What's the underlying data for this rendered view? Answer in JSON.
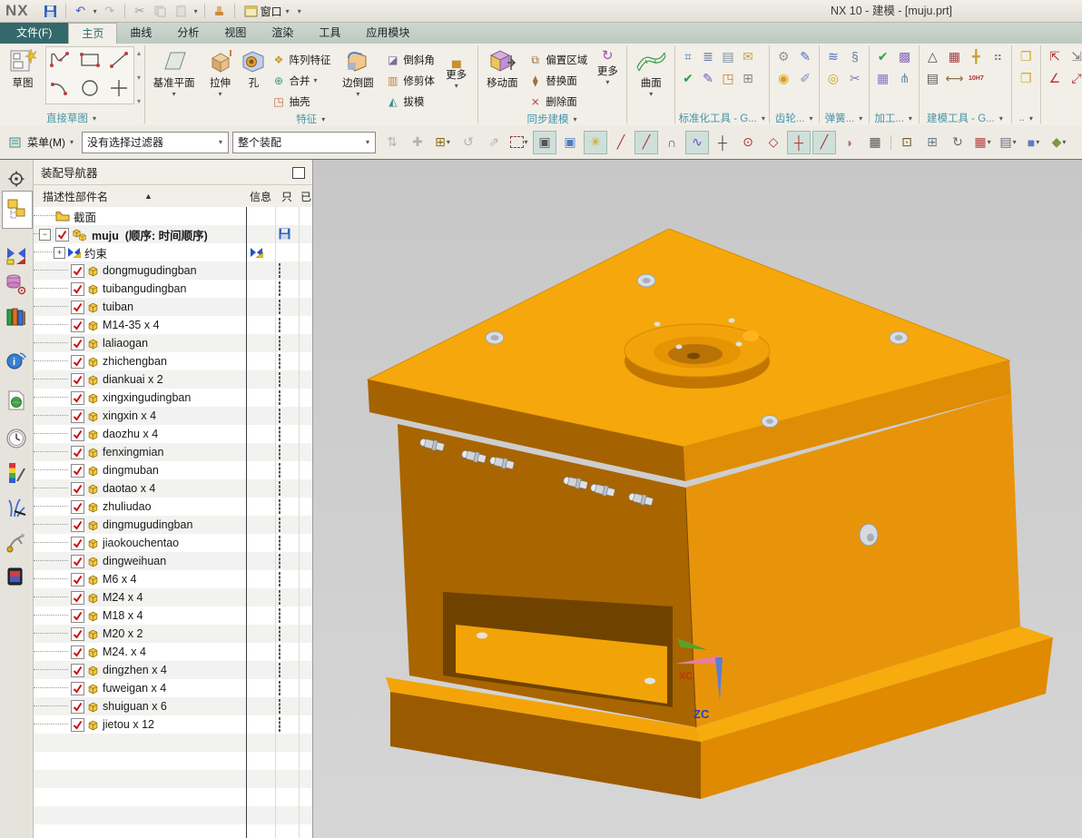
{
  "titlebar": {
    "brand": "NX",
    "title": "NX 10 - 建模 - [muju.prt]",
    "window_menu": "窗口"
  },
  "tabs": {
    "items": [
      "文件(F)",
      "主页",
      "曲线",
      "分析",
      "视图",
      "渲染",
      "工具",
      "应用模块"
    ],
    "active_index": 1
  },
  "ribbon": {
    "direct_sketch": {
      "sketch": "草图",
      "label": "直接草图"
    },
    "feature": {
      "datum": "基准平面",
      "extrude": "拉伸",
      "hole": "孔",
      "pattern": "阵列特征",
      "unite": "合并",
      "shell": "抽壳",
      "blend": "边倒圆",
      "chamfer": "倒斜角",
      "trim": "修剪体",
      "draft": "拔模",
      "more": "更多",
      "label": "特征"
    },
    "sync": {
      "move": "移动面",
      "offset": "偏置区域",
      "replace": "替换面",
      "del": "删除面",
      "more": "更多",
      "label": "同步建模"
    },
    "surface": {
      "surface": "曲面"
    },
    "std": {
      "label": "标准化工具 - G..."
    },
    "gear": {
      "label": "齿轮..."
    },
    "spring": {
      "label": "弹簧..."
    },
    "mach": {
      "label": "加工..."
    },
    "modeling": {
      "label": "建模工具 - G...",
      "fit_text": "10H7"
    },
    "misc": {
      "label": ".."
    }
  },
  "selbar": {
    "menu": "菜单(M)",
    "filter_value": "没有选择过滤器",
    "scope_value": "整个装配",
    "icons": [
      {
        "name": "remember-constraints-icon",
        "glyph": "⇅",
        "gray": 1
      },
      {
        "name": "move-component-icon",
        "glyph": "✚",
        "gray": 1
      },
      {
        "name": "point-dialog-icon",
        "glyph": "⊞",
        "dd": 1,
        "color": "#8a6d1a"
      },
      {
        "name": "rotate-component-icon",
        "glyph": "↺",
        "gray": 1
      },
      {
        "name": "align-component-icon",
        "glyph": "⇗",
        "gray": 1
      },
      {
        "name": "selection-rectangle-icon",
        "box": 1,
        "dd": 1
      },
      {
        "name": "highlight-solid-icon",
        "glyph": "▣",
        "hl": 1,
        "color": "#555555"
      },
      {
        "name": "shaded-block-icon",
        "glyph": "▣",
        "color": "#4a7dc0"
      },
      {
        "name": "dynamic-handle-icon",
        "glyph": "✳",
        "hl": 1,
        "color": "#caa21f"
      },
      {
        "name": "snap-line-icon",
        "glyph": "╱",
        "color": "#b03030"
      },
      {
        "name": "snap-segment-icon",
        "glyph": "╱",
        "hl": 1,
        "color": "#b03030"
      },
      {
        "name": "snap-curve-icon",
        "glyph": "∩",
        "color": "#555555"
      },
      {
        "name": "snap-spline-icon",
        "glyph": "∿",
        "hl": 1,
        "color": "#7a3fc0"
      },
      {
        "name": "snap-intersection-icon",
        "glyph": "┼",
        "color": "#444444"
      },
      {
        "name": "arc-center-icon",
        "glyph": "⊙",
        "color": "#b03030"
      },
      {
        "name": "quadrant-point-icon",
        "glyph": "◇",
        "color": "#b03030"
      },
      {
        "name": "snap-point-icon",
        "glyph": "┼",
        "hl": 1,
        "color": "#b03030"
      },
      {
        "name": "snap-endpoint-icon",
        "glyph": "╱",
        "hl": 1,
        "color": "#b03030"
      },
      {
        "name": "snap-face-icon",
        "glyph": "◗",
        "color": "#b06a8a"
      },
      {
        "name": "snap-grid-icon",
        "glyph": "▦",
        "color": "#555555"
      },
      {
        "sep": 1
      },
      {
        "name": "fit-view-icon",
        "glyph": "⊡",
        "color": "#6a5a20"
      },
      {
        "name": "zoom-window-icon",
        "glyph": "⊞",
        "color": "#6a7a8a"
      },
      {
        "name": "rotate-view-icon",
        "glyph": "↻",
        "color": "#666677"
      },
      {
        "name": "window-layout-icon",
        "glyph": "▦",
        "dd": 1,
        "color": "#b04040"
      },
      {
        "name": "render-style-icon",
        "glyph": "▤",
        "dd": 1,
        "color": "#666677"
      },
      {
        "name": "shaded-view-icon",
        "glyph": "■",
        "dd": 1,
        "color": "#5a7ec0"
      },
      {
        "name": "clip-section-icon",
        "glyph": "◆",
        "dd": 1,
        "color": "#7a9a40"
      }
    ]
  },
  "rail": {
    "icons": [
      {
        "name": "gear-icon"
      },
      {
        "name": "assembly-navigator-icon",
        "active": 1
      },
      {
        "name": "constraint-navigator-icon"
      },
      {
        "name": "part-navigator-icon"
      },
      {
        "name": "reuse-library-icon"
      },
      {
        "name": "web-browser-icon"
      },
      {
        "name": "hd3d-tool-icon"
      },
      {
        "name": "history-icon"
      },
      {
        "name": "system-materials-icon"
      },
      {
        "name": "visualization-icon"
      },
      {
        "name": "machinery-library-icon"
      },
      {
        "name": "touch-mode-icon"
      }
    ]
  },
  "navigator": {
    "title": "装配导航器",
    "columns": [
      "描述性部件名",
      "信息",
      "只",
      "已"
    ],
    "rows": [
      {
        "type": "folder",
        "label": "截面"
      },
      {
        "type": "root",
        "label": "muju",
        "suffix": "(顺序: 时间顺序)"
      },
      {
        "type": "constraints",
        "label": "约束"
      },
      {
        "type": "part",
        "label": "dongmugudingban"
      },
      {
        "type": "part",
        "label": "tuibangudingban"
      },
      {
        "type": "part",
        "label": "tuiban"
      },
      {
        "type": "part",
        "label": "M14-35 x 4"
      },
      {
        "type": "part",
        "label": "laliaogan"
      },
      {
        "type": "part",
        "label": "zhichengban"
      },
      {
        "type": "part",
        "label": "diankuai x 2"
      },
      {
        "type": "part",
        "label": "xingxingudingban"
      },
      {
        "type": "part",
        "label": "xingxin x 4"
      },
      {
        "type": "part",
        "label": "daozhu x 4"
      },
      {
        "type": "part",
        "label": "fenxingmian"
      },
      {
        "type": "part",
        "label": "dingmuban"
      },
      {
        "type": "part",
        "label": "daotao x 4"
      },
      {
        "type": "part",
        "label": "zhuliudao"
      },
      {
        "type": "part",
        "label": "dingmugudingban"
      },
      {
        "type": "part",
        "label": "jiaokouchentao"
      },
      {
        "type": "part",
        "label": "dingweihuan"
      },
      {
        "type": "part",
        "label": "M6 x 4"
      },
      {
        "type": "part",
        "label": "M24 x 4"
      },
      {
        "type": "part",
        "label": "M18 x 4"
      },
      {
        "type": "part",
        "label": "M20 x 2"
      },
      {
        "type": "part",
        "label": "M24. x 4"
      },
      {
        "type": "part",
        "label": "dingzhen x 4"
      },
      {
        "type": "part",
        "label": "fuweigan x 4"
      },
      {
        "type": "part",
        "label": "shuiguan x 6"
      },
      {
        "type": "part",
        "label": "jietou x 12"
      }
    ]
  },
  "viewport": {
    "triad": {
      "x": "XC",
      "z": "ZC"
    },
    "model_colors": {
      "top_face": "#f6a70b",
      "left_face": "#a96500",
      "right_face": "#e8940b",
      "base_dark": "#9a5a00",
      "notch_shadow": "#6f4200",
      "fitting_silver": "#d4d9de"
    }
  }
}
